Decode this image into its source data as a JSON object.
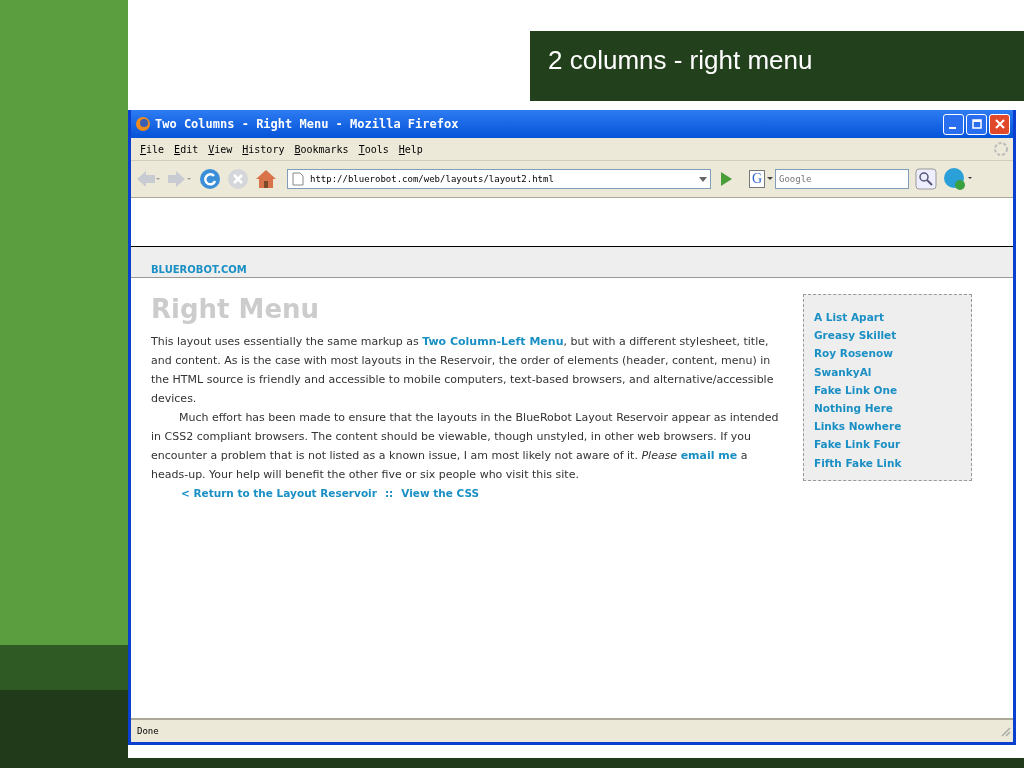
{
  "slide": {
    "title": "2 columns - right menu"
  },
  "browser": {
    "title": "Two Columns - Right Menu - Mozilla Firefox",
    "menu": [
      "File",
      "Edit",
      "View",
      "History",
      "Bookmarks",
      "Tools",
      "Help"
    ],
    "address": "http://bluerobot.com/web/layouts/layout2.html",
    "search_placeholder": "Google",
    "search_engine": "G",
    "status": "Done"
  },
  "page": {
    "site_name": "BLUEROBOT.COM",
    "heading": "Right Menu",
    "paragraphs": [
      [
        {
          "kind": "text",
          "text": "This layout uses essentially the same markup as "
        },
        {
          "kind": "link",
          "text": "Two Column-Left Menu"
        },
        {
          "kind": "text",
          "text": ", but with a different stylesheet, title, and content. As is the case with most layouts in the Reservoir, the order of elements (header, content, menu) in the HTML source is friendly and accessible to mobile computers, text-based browsers, and alternative/accessible devices."
        }
      ],
      [
        {
          "kind": "text",
          "text": "Much effort has been made to ensure that the layouts in the BlueRobot Layout Reservoir appear as intended in CSS2 compliant browsers. The content should be viewable, though unstyled, in other web browsers. If you encounter a problem that is not listed as a known issue, I am most likely not aware of it. "
        },
        {
          "kind": "em",
          "text": "Please "
        },
        {
          "kind": "link",
          "text": "email me"
        },
        {
          "kind": "text",
          "text": " a heads-up. Your help will benefit the other five or six people who visit this site."
        }
      ]
    ],
    "footer_links": [
      "< Return to the Layout Reservoir",
      "View the CSS"
    ],
    "separator": "::",
    "menu_links": [
      "A List Apart",
      "Greasy Skillet",
      "Roy Rosenow",
      "SwankyAl",
      "Fake Link One",
      "Nothing Here",
      "Links Nowhere",
      "Fake Link Four",
      "Fifth Fake Link"
    ]
  }
}
